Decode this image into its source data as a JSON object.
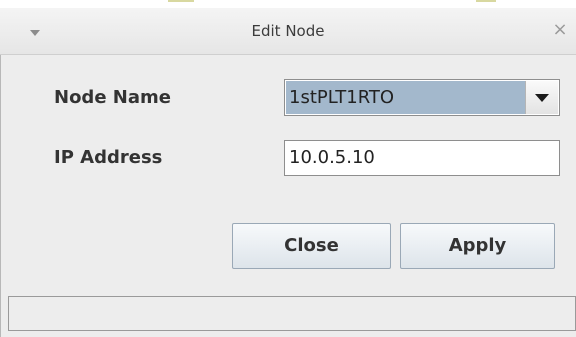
{
  "window": {
    "title": "Edit Node",
    "close_glyph": "×"
  },
  "form": {
    "node_name_label": "Node Name",
    "node_name_value": "1stPLT1RTO",
    "ip_address_label": "IP Address",
    "ip_address_value": "10.0.5.10"
  },
  "buttons": {
    "close_label": "Close",
    "apply_label": "Apply"
  },
  "colors": {
    "selection_highlight": "#a3b8cc",
    "button_border": "#9aa8b6"
  },
  "icons": {
    "menu": "chevron-down-icon",
    "close": "close-icon",
    "dropdown": "dropdown-arrow-icon"
  }
}
